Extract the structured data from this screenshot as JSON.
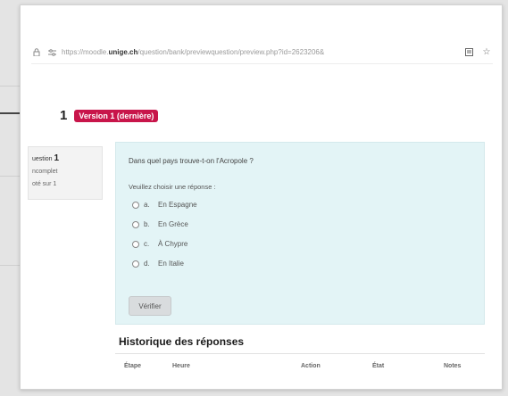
{
  "browser": {
    "url_prefix": "https://moodle.",
    "url_domain": "unige.ch",
    "url_path": "/question/bank/previewquestion/preview.php?id=2623206&"
  },
  "question_header": {
    "number": "1",
    "version_badge": "Version 1 (dernière)"
  },
  "question_info": {
    "label": "uestion",
    "number": "1",
    "status": "ncomplet",
    "points": "oté sur 1"
  },
  "question": {
    "text": "Dans quel pays trouve-t-on l'Acropole ?",
    "prompt": "Veuillez choisir une réponse :",
    "options": [
      {
        "letter": "a.",
        "text": "En Espagne"
      },
      {
        "letter": "b.",
        "text": "En Grèce"
      },
      {
        "letter": "c.",
        "text": "À Chypre"
      },
      {
        "letter": "d.",
        "text": "En Italie"
      }
    ],
    "check_button": "Vérifier"
  },
  "history": {
    "title": "Historique des réponses",
    "columns": [
      "Étape",
      "Heure",
      "Action",
      "État",
      "Notes"
    ]
  },
  "colors": {
    "badge": "#c8154a",
    "question_background": "#e3f4f6",
    "button": "#d9dcde"
  },
  "icons": {
    "address_bar": [
      "lock-icon",
      "tune-icon",
      "reader-icon",
      "star-icon"
    ],
    "option_control": "radio-icon"
  }
}
